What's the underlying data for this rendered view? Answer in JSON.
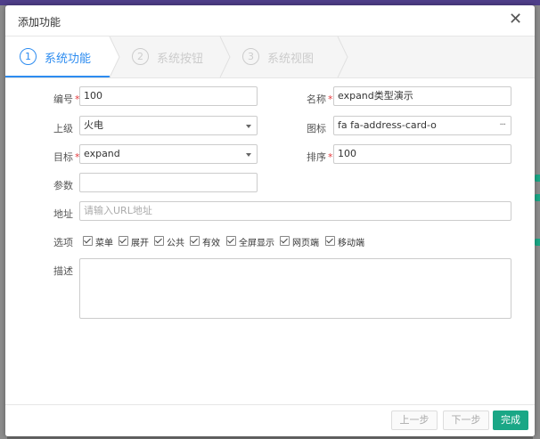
{
  "dialog": {
    "title": "添加功能"
  },
  "steps": [
    {
      "num": "1",
      "label": "系统功能"
    },
    {
      "num": "2",
      "label": "系统按钮"
    },
    {
      "num": "3",
      "label": "系统视图"
    }
  ],
  "form": {
    "code_label": "编号",
    "code_value": "100",
    "name_label": "名称",
    "name_value": "expand类型演示",
    "parent_label": "上级",
    "parent_value": "火电",
    "icon_label": "图标",
    "icon_value": "fa fa-address-card-o",
    "icon_more": "···",
    "target_label": "目标",
    "target_value": "expand",
    "sort_label": "排序",
    "sort_value": "100",
    "param_label": "参数",
    "param_value": "",
    "address_label": "地址",
    "address_placeholder": "请输入URL地址",
    "options_label": "选项",
    "options": [
      "菜单",
      "展开",
      "公共",
      "有效",
      "全屏显示",
      "网页端",
      "移动端"
    ],
    "desc_label": "描述",
    "required_mark": "*"
  },
  "footer": {
    "prev": "上一步",
    "next": "下一步",
    "finish": "完成"
  }
}
